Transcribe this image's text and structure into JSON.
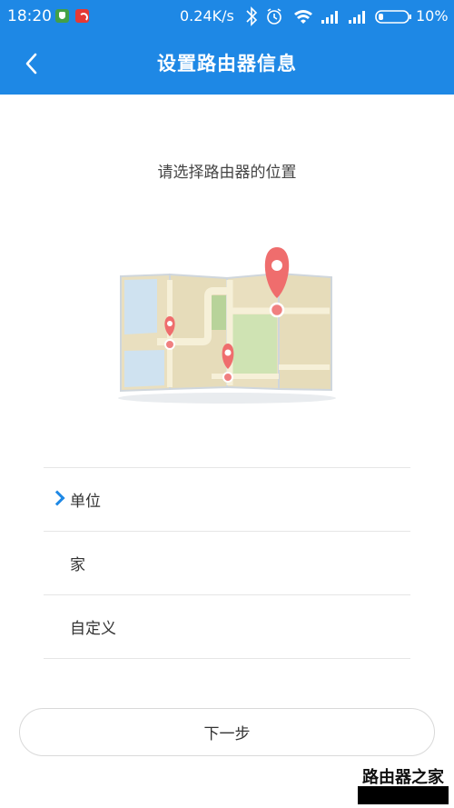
{
  "status_bar": {
    "time": "18:20",
    "network_speed": "0.24K/s",
    "battery": "10%",
    "icons": [
      "shield-notification-icon",
      "wifi-notification-icon",
      "bluetooth-icon",
      "alarm-icon",
      "wifi-icon",
      "signal-icon",
      "signal-icon",
      "battery-icon"
    ]
  },
  "app_bar": {
    "title": "设置路由器信息",
    "back_icon": "chevron-left-icon",
    "color": "#1e88e5"
  },
  "prompt": "请选择路由器的位置",
  "illustration": "map-with-location-pins",
  "options": [
    {
      "label": "单位",
      "selected": true
    },
    {
      "label": "家",
      "selected": false
    },
    {
      "label": "自定义",
      "selected": false
    }
  ],
  "next_button": "下一步",
  "watermark": {
    "text": "路由器之家"
  }
}
